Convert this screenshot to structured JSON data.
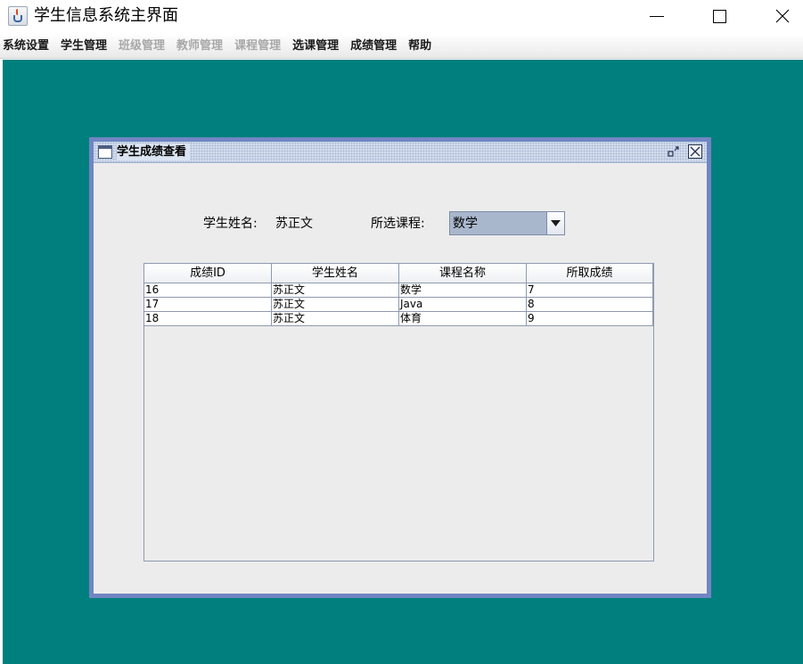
{
  "window": {
    "title": "学生信息系统主界面",
    "icon": "java-app-icon"
  },
  "menubar": {
    "items": [
      {
        "label": "系统设置",
        "enabled": true
      },
      {
        "label": "学生管理",
        "enabled": true
      },
      {
        "label": "班级管理",
        "enabled": false
      },
      {
        "label": "教师管理",
        "enabled": false
      },
      {
        "label": "课程管理",
        "enabled": false
      },
      {
        "label": "选课管理",
        "enabled": true
      },
      {
        "label": "成绩管理",
        "enabled": true
      },
      {
        "label": "帮助",
        "enabled": true
      }
    ]
  },
  "desktop": {
    "background": "#007f7f"
  },
  "internal_frame": {
    "title": "学生成绩查看",
    "student_name_label": "学生姓名:",
    "student_name_value": "苏正文",
    "course_label": "所选课程:",
    "course_selected": "数学",
    "table": {
      "columns": [
        "成绩ID",
        "学生姓名",
        "课程名称",
        "所取成绩"
      ],
      "rows": [
        [
          "16",
          "苏正文",
          "数学",
          "7"
        ],
        [
          "17",
          "苏正文",
          "Java",
          "8"
        ],
        [
          "18",
          "苏正文",
          "体育",
          "9"
        ]
      ]
    }
  }
}
